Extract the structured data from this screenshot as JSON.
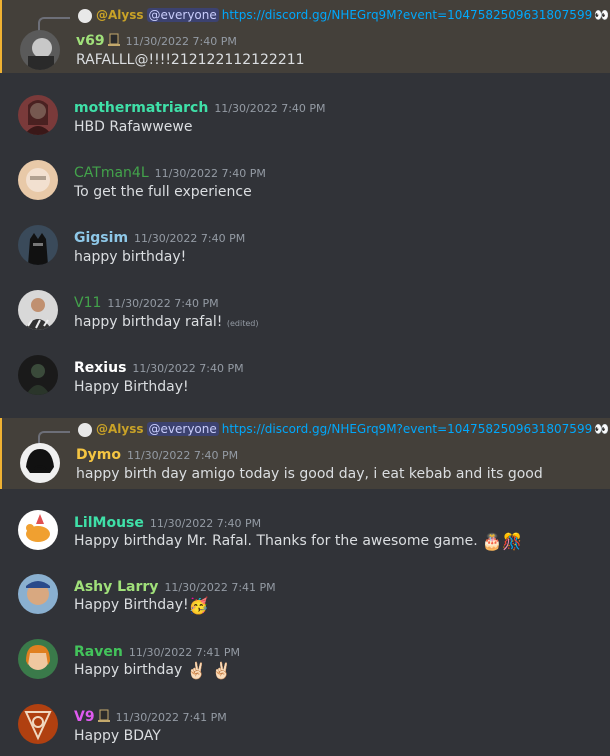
{
  "messages": [
    {
      "username": "v69",
      "color": "#a0e07a",
      "time": "11/30/2022 7:40 PM",
      "text": "RAFALLL@!!!!212122112122211",
      "reply": {
        "name": "@Alyss",
        "everyone": "@everyone",
        "link": "https://discord.gg/NHEGrq9M?event=1047582509631807599",
        "eyes": "👀"
      }
    },
    {
      "username": "mothermatriarch",
      "color": "#3fe0a8",
      "time": "11/30/2022 7:40 PM",
      "text": "HBD Rafawwewe"
    },
    {
      "username": "CATman4L",
      "color": "#43a34b",
      "time": "11/30/2022 7:40 PM",
      "text": "To get the full experience"
    },
    {
      "username": "Gigsim",
      "color": "#8ec8e8",
      "time": "11/30/2022 7:40 PM",
      "text": "happy birthday!"
    },
    {
      "username": "V11",
      "color": "#43a34b",
      "time": "11/30/2022 7:40 PM",
      "text": "happy birthday rafal!",
      "edited": "(edited)"
    },
    {
      "username": "Rexius",
      "color": "#ffffff",
      "time": "11/30/2022 7:40 PM",
      "text": "Happy Birthday!"
    },
    {
      "username": "Dymo",
      "color": "#f5c542",
      "time": "11/30/2022 7:40 PM",
      "text": "happy birth day amigo today is good day, i eat kebab and its good",
      "reply": {
        "name": "@Alyss",
        "everyone": "@everyone",
        "link": "https://discord.gg/NHEGrq9M?event=1047582509631807599",
        "eyes": "👀"
      }
    },
    {
      "username": "LilMouse",
      "color": "#3fe0a8",
      "time": "11/30/2022 7:40 PM",
      "text": "Happy birthday Mr. Rafal. Thanks for the awesome game.",
      "emoji": "🎂🎊"
    },
    {
      "username": "Ashy Larry",
      "color": "#a0e07a",
      "time": "11/30/2022 7:41 PM",
      "text": "Happy Birthday!",
      "emoji": "🥳"
    },
    {
      "username": "Raven",
      "color": "#43c35b",
      "time": "11/30/2022 7:41 PM",
      "text": "Happy birthday",
      "emoji": "✌🏻 ✌🏻"
    },
    {
      "username": "V9",
      "color": "#e05af0",
      "time": "11/30/2022 7:41 PM",
      "text": "Happy BDAY"
    }
  ]
}
